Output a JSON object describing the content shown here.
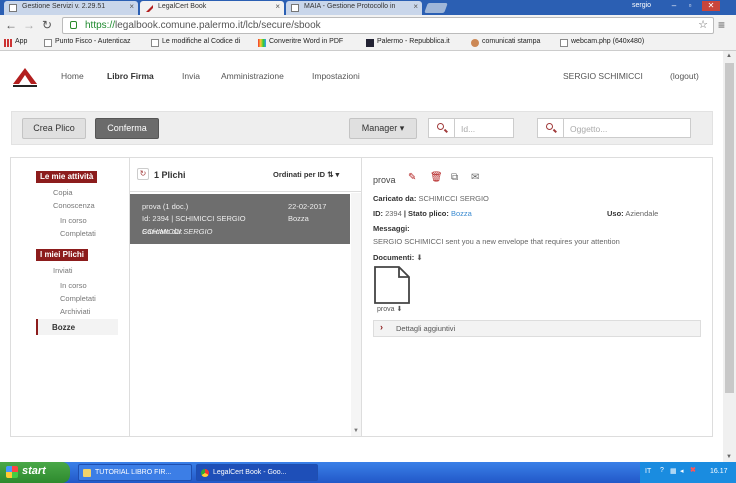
{
  "browser": {
    "tabs": [
      {
        "title": "Gestione Servizi v. 2.29.51"
      },
      {
        "title": "LegalCert Book"
      },
      {
        "title": "MAIA - Gestione Protocollo in"
      }
    ],
    "window_user": "sergio",
    "url_scheme": "https://",
    "url_rest": "legalbook.comune.palermo.it/lcb/secure/sbook",
    "bookmarks": [
      "App",
      "Punto Fisco - Autenticaz",
      "Le modifiche al Codice di",
      "Converitre Word in PDF",
      "Palermo - Repubblica.it",
      "comunicati stampa",
      "webcam.php (640x480)"
    ]
  },
  "nav": {
    "items": [
      "Home",
      "Libro Firma",
      "Invia",
      "Amministrazione",
      "Impostazioni"
    ],
    "user": "SERGIO SCHIMICCI",
    "logout": "(logout)"
  },
  "toolbar": {
    "create": "Crea Plico",
    "confirm": "Conferma",
    "manager": "Manager",
    "id_placeholder": "Id...",
    "subject_placeholder": "Oggetto..."
  },
  "sidebar": {
    "section1": "Le mie attività",
    "s1_items": [
      "Copia",
      "Conoscenza"
    ],
    "s1_sub": [
      "In corso",
      "Completati"
    ],
    "section2": "I miei Plichi",
    "s2_items": [
      "Inviati"
    ],
    "s2_sub": [
      "In corso",
      "Completati",
      "Archiviati"
    ],
    "active": "Bozze"
  },
  "list": {
    "count": "1 Plichi",
    "sort": "Ordinati per ID",
    "item": {
      "name": "prova (1 doc.)",
      "date": "22-02-2017",
      "id": "Id: 2394 | SCHIMICCI SERGIO",
      "status": "Bozza",
      "loaded_label": "Caricato da:",
      "loaded_by": "SCHIMICCI SERGIO"
    }
  },
  "detail": {
    "title": "prova",
    "loaded_label": "Caricato da:",
    "loaded_by": "SCHIMICCI SERGIO",
    "id_label": "ID:",
    "id_value": "2394",
    "status_label": "| Stato plico:",
    "status_value": "Bozza",
    "use_label": "Uso:",
    "use_value": "Aziendale",
    "message_label": "Messaggi:",
    "message": "SERGIO SCHIMICCI sent you a new envelope that requires your attention",
    "docs_label": "Documenti:",
    "doc_name": "prova",
    "details_toggle": "Dettagli aggiuntivi"
  },
  "taskbar": {
    "start": "start",
    "buttons": [
      "TUTORIAL LIBRO FIR...",
      "LegalCert Book - Goo..."
    ],
    "lang": "IT",
    "time": "16.17"
  }
}
